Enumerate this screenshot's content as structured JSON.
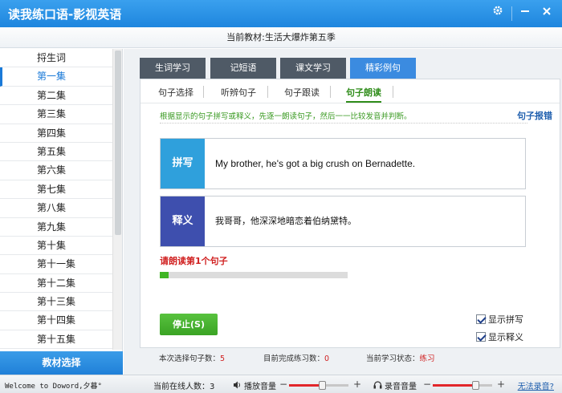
{
  "app": {
    "title": "读我练口语-影视英语"
  },
  "header": {
    "current_textbook": "当前教材:生活大爆炸第五季"
  },
  "sidebar": {
    "items": [
      "捋生词",
      "第一集",
      "第二集",
      "第三集",
      "第四集",
      "第五集",
      "第六集",
      "第七集",
      "第八集",
      "第九集",
      "第十集",
      "第十一集",
      "第十二集",
      "第十三集",
      "第十四集",
      "第十五集"
    ],
    "active_index": 1,
    "select_button": "教材选择"
  },
  "main_tabs": [
    {
      "label": "生词学习",
      "active": false
    },
    {
      "label": "记短语",
      "active": false
    },
    {
      "label": "课文学习",
      "active": false
    },
    {
      "label": "精彩例句",
      "active": true
    }
  ],
  "sub_tabs": [
    {
      "label": "句子选择",
      "active": false
    },
    {
      "label": "听辨句子",
      "active": false
    },
    {
      "label": "句子跟读",
      "active": false
    },
    {
      "label": "句子朗读",
      "active": true
    }
  ],
  "panel": {
    "hint": "根据显示的句子拼写或释义，先逐一朗读句子，然后一一比较发音并判断。",
    "report_link": "句子报错",
    "spelling": {
      "tag": "拼写",
      "text": "My brother, he's got a big crush on Bernadette.",
      "color": "#2fa0dc"
    },
    "meaning": {
      "tag": "释义",
      "text": "我哥哥，他深深地暗恋着伯纳黛特。",
      "color": "#3e4fae"
    },
    "prompt": "请朗读第1个句子",
    "progress": 0.045,
    "stop_button": "停止(S)",
    "show_spelling": {
      "label": "显示拼写",
      "checked": true
    },
    "show_meaning": {
      "label": "显示释义",
      "checked": true
    }
  },
  "stats": {
    "selected_label": "本次选择句子数：",
    "selected_value": "5",
    "done_label": "目前完成练习数：",
    "done_value": "0",
    "state_label": "当前学习状态：",
    "state_value": "练习"
  },
  "statusbar": {
    "welcome": "Welcome to Doword,夕暮°",
    "online": "当前在线人数：3",
    "play_volume_label": "播放音量",
    "play_volume": 0.55,
    "minus": "−",
    "plus": "+",
    "record_volume_label": "录音音量",
    "record_volume": 0.72,
    "no_recording": "无法录音?"
  },
  "icons": {
    "settings": "gear-icon",
    "minimize": "minimize-icon",
    "close": "close-icon",
    "speaker": "speaker-icon",
    "headset": "headset-icon"
  }
}
